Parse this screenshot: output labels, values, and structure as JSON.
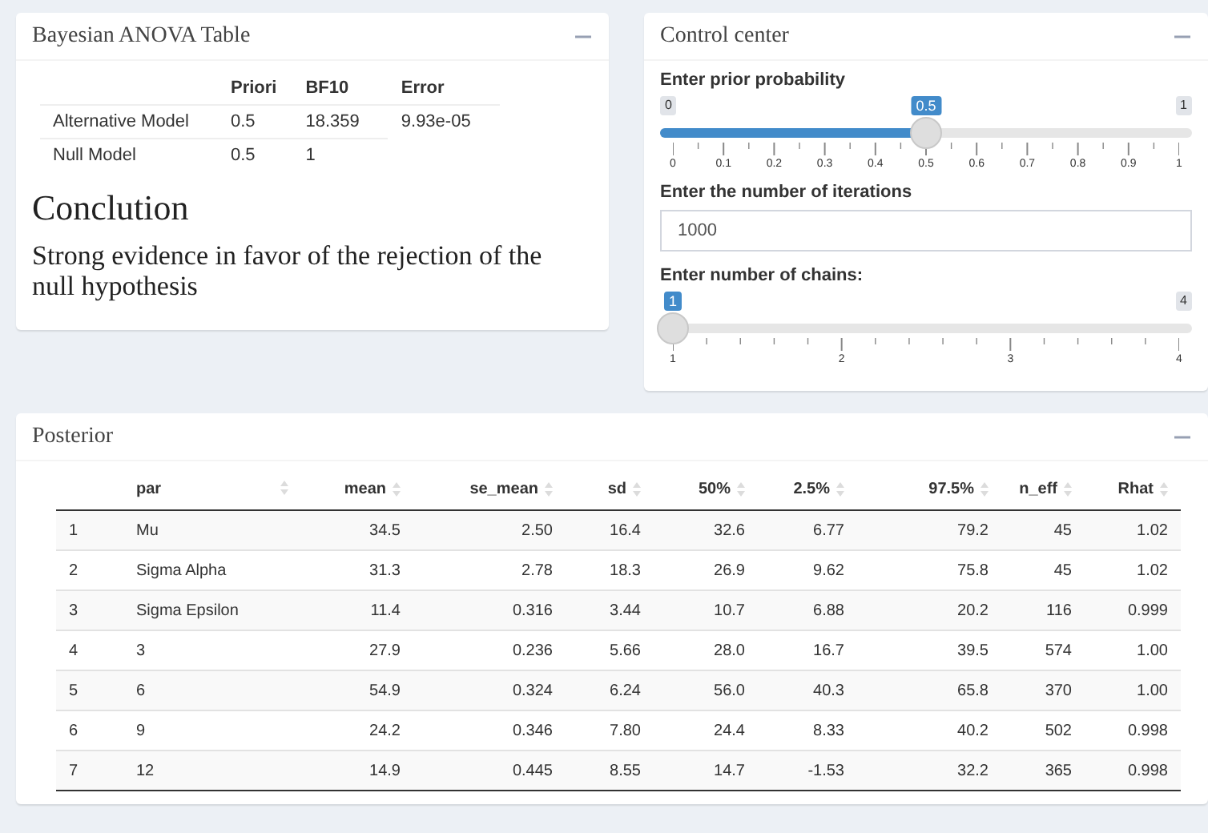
{
  "anova": {
    "title": "Bayesian ANOVA Table",
    "columns": [
      "Priori",
      "BF10",
      "Error"
    ],
    "rows": [
      {
        "model": "Alternative Model",
        "cells": [
          "0.5",
          "18.359",
          "9.93e-05"
        ]
      },
      {
        "model": "Null Model",
        "cells": [
          "0.5",
          "1"
        ]
      }
    ],
    "conclusion_heading": "Conclution",
    "conclusion": "Strong evidence in favor of the rejection of the null hypothesis"
  },
  "control_center": {
    "title": "Control center",
    "controls": [
      {
        "kind": "slider",
        "label": "Enter prior probability",
        "min": "0",
        "max": "1",
        "value": "0.5",
        "level": 0.5,
        "ticks": [
          "0",
          "0.1",
          "0.2",
          "0.3",
          "0.4",
          "0.5",
          "0.6",
          "0.7",
          "0.8",
          "0.9",
          "1"
        ]
      },
      {
        "kind": "number",
        "label": "Enter the number of iterations",
        "value": "1000"
      },
      {
        "kind": "slider",
        "label": "Enter number of chains:",
        "max": "4",
        "value": "1",
        "level": 0,
        "ticks": [
          "1",
          "2",
          "3",
          "4"
        ]
      }
    ]
  },
  "posterior": {
    "title": "Posterior",
    "columns": [
      "par",
      "mean",
      "se_mean",
      "sd",
      "50%",
      "2.5%",
      "97.5%",
      "n_eff",
      "Rhat"
    ],
    "rows": [
      {
        "index": "1",
        "cells": [
          "Mu",
          "34.5",
          "2.50",
          "16.4",
          "32.6",
          "6.77",
          "79.2",
          "45",
          "1.02"
        ]
      },
      {
        "index": "2",
        "cells": [
          "Sigma Alpha",
          "31.3",
          "2.78",
          "18.3",
          "26.9",
          "9.62",
          "75.8",
          "45",
          "1.02"
        ]
      },
      {
        "index": "3",
        "cells": [
          "Sigma Epsilon",
          "11.4",
          "0.316",
          "3.44",
          "10.7",
          "6.88",
          "20.2",
          "116",
          "0.999"
        ]
      },
      {
        "index": "4",
        "cells": [
          "3",
          "27.9",
          "0.236",
          "5.66",
          "28.0",
          "16.7",
          "39.5",
          "574",
          "1.00"
        ]
      },
      {
        "index": "5",
        "cells": [
          "6",
          "54.9",
          "0.324",
          "6.24",
          "56.0",
          "40.3",
          "65.8",
          "370",
          "1.00"
        ]
      },
      {
        "index": "6",
        "cells": [
          "9",
          "24.2",
          "0.346",
          "7.80",
          "24.4",
          "8.33",
          "40.2",
          "502",
          "0.998"
        ]
      },
      {
        "index": "7",
        "cells": [
          "12",
          "14.9",
          "0.445",
          "8.55",
          "14.7",
          "-1.53",
          "32.2",
          "365",
          "0.998"
        ]
      }
    ]
  }
}
